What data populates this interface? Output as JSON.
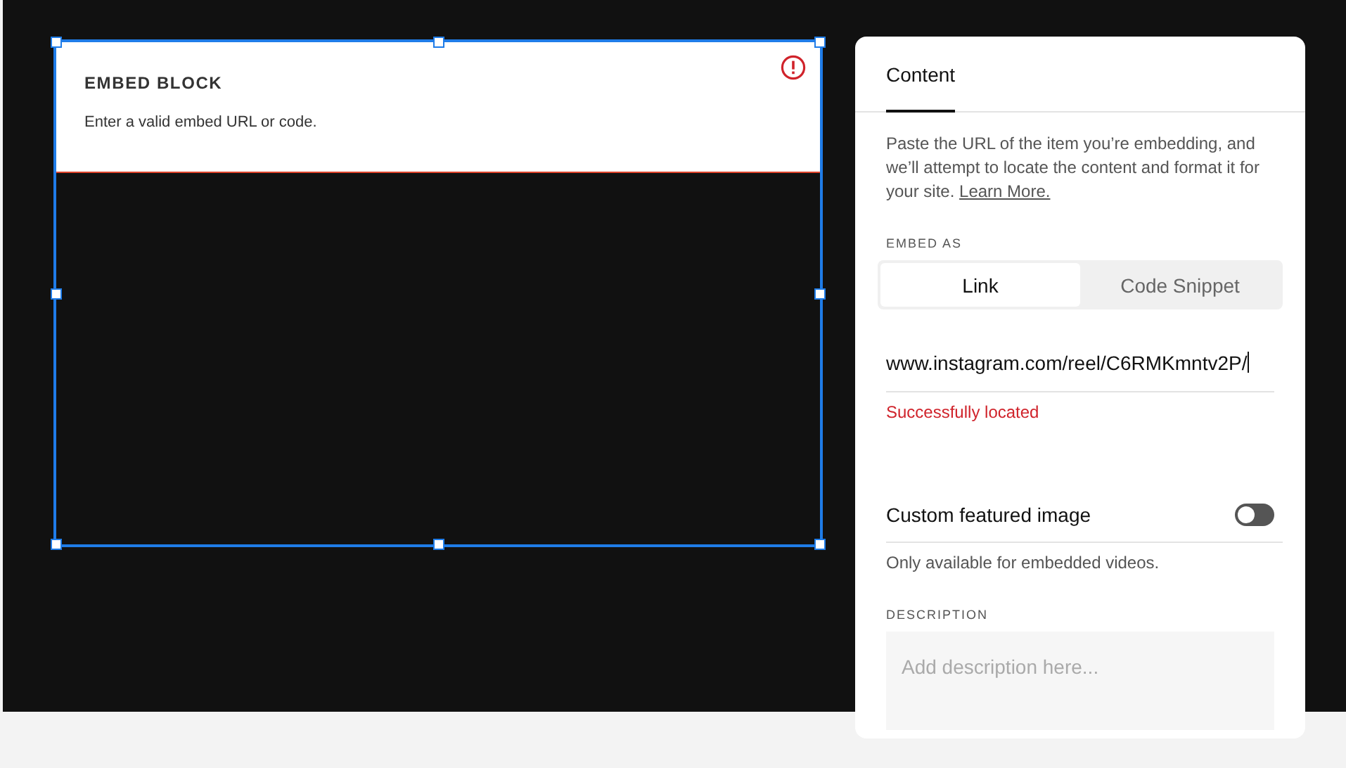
{
  "embed_block": {
    "title": "EMBED BLOCK",
    "message": "Enter a valid embed URL or code.",
    "error": true,
    "selected": true
  },
  "panel": {
    "tabs": [
      {
        "label": "Content",
        "selected": true
      }
    ],
    "intro": "Paste the URL of the item you’re embedding, and we’ll attempt to locate the content and format it for your site.",
    "learn_more": "Learn More.",
    "embed_as": {
      "label": "EMBED AS",
      "options": [
        {
          "label": "Link",
          "selected": true
        },
        {
          "label": "Code Snippet",
          "selected": false
        }
      ]
    },
    "url": {
      "value": "www.instagram.com/reel/C6RMKmntv2P/",
      "status": "Successfully located"
    },
    "custom_image": {
      "label": "Custom featured image",
      "on": false,
      "note": "Only available for embedded videos."
    },
    "description": {
      "label": "DESCRIPTION",
      "placeholder": "Add description here..."
    }
  }
}
